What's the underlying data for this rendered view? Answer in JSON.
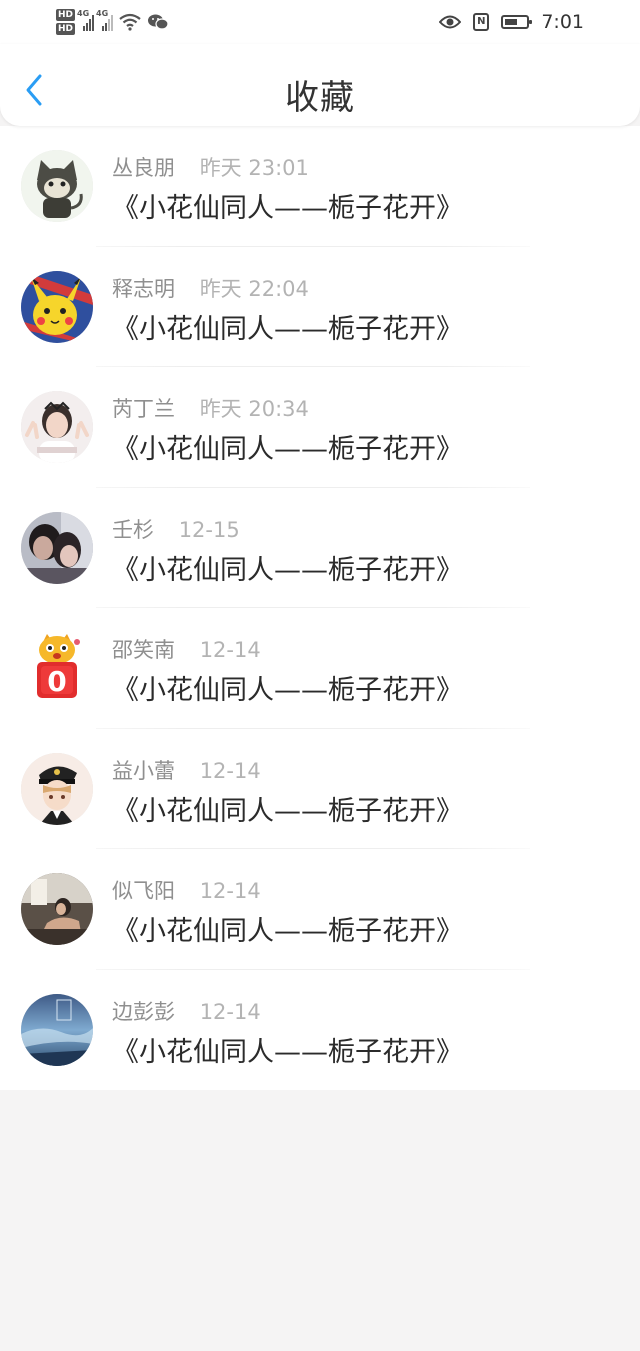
{
  "status_bar": {
    "time": "7:01",
    "hd1": "HD",
    "hd2": "HD",
    "net1": "4G",
    "net2": "4G",
    "nfc": "N"
  },
  "header": {
    "title": "收藏",
    "back_icon": "chevron-left-icon",
    "accent": "#2a9df4"
  },
  "items": [
    {
      "name": "丛良朋",
      "time": "昨天 23:01",
      "title": "《小花仙同人——栀子花开》",
      "avatar": "cat-avatar"
    },
    {
      "name": "释志明",
      "time": "昨天 22:04",
      "title": "《小花仙同人——栀子花开》",
      "avatar": "pikachu-avatar"
    },
    {
      "name": "芮丁兰",
      "time": "昨天 20:34",
      "title": "《小花仙同人——栀子花开》",
      "avatar": "girl-avatar"
    },
    {
      "name": "壬杉",
      "time": "12-15",
      "title": "《小花仙同人——栀子花开》",
      "avatar": "couple-avatar"
    },
    {
      "name": "邵笑南",
      "time": "12-14",
      "title": "《小花仙同人——栀子花开》",
      "avatar": "cartoon-badge-avatar"
    },
    {
      "name": "益小蕾",
      "time": "12-14",
      "title": "《小花仙同人——栀子花开》",
      "avatar": "anime-captain-avatar"
    },
    {
      "name": "似飞阳",
      "time": "12-14",
      "title": "《小花仙同人——栀子花开》",
      "avatar": "photo-avatar"
    },
    {
      "name": "边彭彭",
      "time": "12-14",
      "title": "《小花仙同人——栀子花开》",
      "avatar": "ocean-avatar"
    }
  ]
}
